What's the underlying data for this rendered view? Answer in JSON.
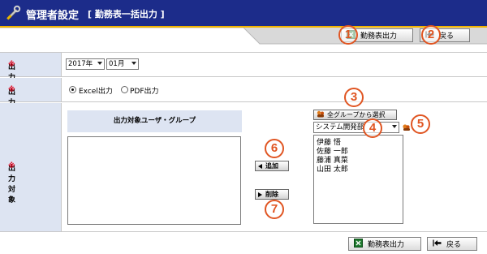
{
  "header": {
    "title": "管理者設定",
    "subtitle": "[ 勤務表一括出力 ]"
  },
  "actions": {
    "export_label": "勤務表出力",
    "back_label": "戻る"
  },
  "markers": [
    "1",
    "2",
    "3",
    "4",
    "5",
    "6",
    "7"
  ],
  "form": {
    "month_row": {
      "label": "出力対象月",
      "required_mark": "※",
      "year": "2017年",
      "month": "01月"
    },
    "format_row": {
      "label": "出力形式",
      "required_mark": "※",
      "options": [
        "Excel出力",
        "PDF出力"
      ],
      "selected": "Excel出力"
    },
    "target_row": {
      "label": "出力対象",
      "required_mark": "※",
      "group_header": "出力対象ユーザ・グループ",
      "select_all_groups_label": "全グループから選択",
      "group_select_value": "システム開発部",
      "add_label": "追加",
      "delete_label": "削除",
      "selected_users": [],
      "candidate_users": [
        "伊藤 悟",
        "佐藤 一郎",
        "藤浦 真菜",
        "山田 太郎"
      ]
    }
  },
  "colors": {
    "title_bg": "#1c2c8a",
    "title_underline": "#f1b300",
    "label_bg": "#dde4f2",
    "required": "#e2001a",
    "marker": "#e05522"
  }
}
